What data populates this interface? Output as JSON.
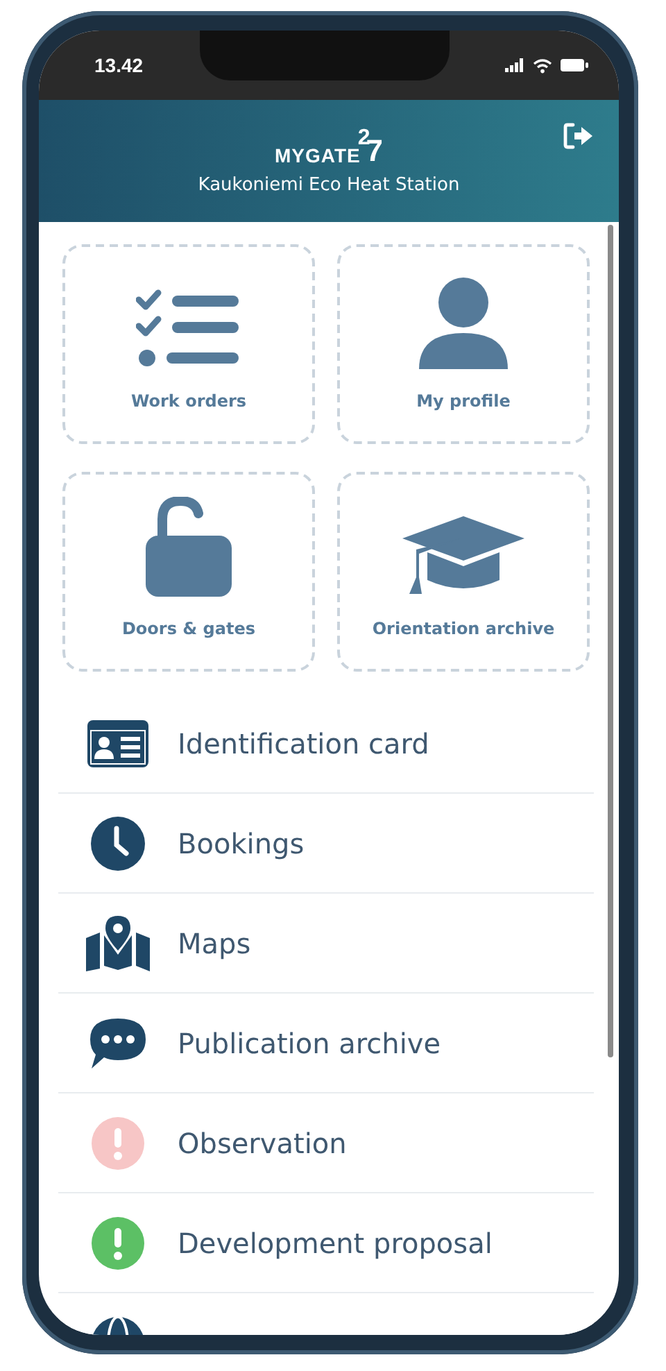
{
  "status_bar": {
    "time": "13.42"
  },
  "header": {
    "logo_text": "MYGATE",
    "logo_digits": [
      "2",
      "7"
    ],
    "site": "Kaukoniemi Eco Heat Station"
  },
  "tiles": [
    {
      "label": "Work orders"
    },
    {
      "label": "My profile"
    },
    {
      "label": "Doors & gates"
    },
    {
      "label": "Orientation archive"
    }
  ],
  "menu": [
    {
      "kind": "icon",
      "label": "Identification card"
    },
    {
      "kind": "icon",
      "label": "Bookings"
    },
    {
      "kind": "icon",
      "label": "Maps"
    },
    {
      "kind": "icon",
      "label": "Publication archive"
    },
    {
      "kind": "alert",
      "label": "Observation",
      "color": "#f7c6c6"
    },
    {
      "kind": "alert",
      "label": "Development proposal",
      "color": "#5cc065"
    },
    {
      "kind": "icon"
    }
  ]
}
